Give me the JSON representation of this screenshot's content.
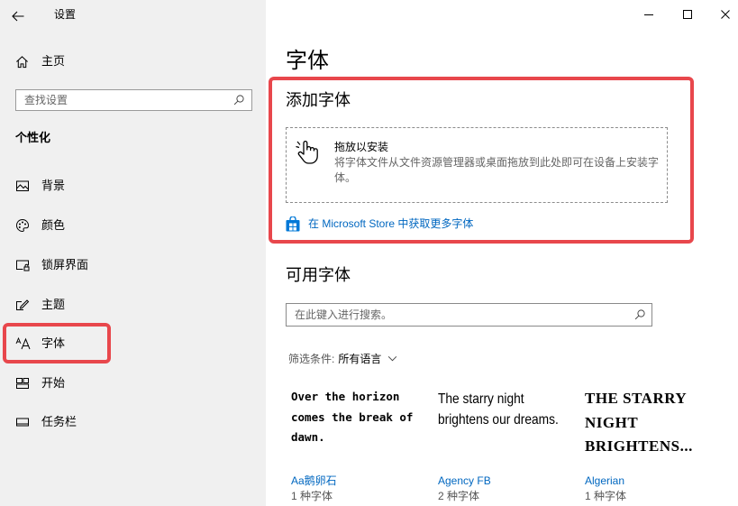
{
  "window": {
    "title": "设置",
    "back_icon": "back-arrow-icon",
    "controls": [
      "minimize-icon",
      "maximize-icon",
      "close-icon"
    ]
  },
  "sidebar": {
    "home": {
      "label": "主页",
      "icon": "home-icon"
    },
    "search": {
      "placeholder": "查找设置",
      "icon": "search-icon"
    },
    "section_title": "个性化",
    "items": [
      {
        "label": "背景",
        "icon": "picture-icon"
      },
      {
        "label": "颜色",
        "icon": "palette-icon"
      },
      {
        "label": "锁屏界面",
        "icon": "lock-screen-icon"
      },
      {
        "label": "主题",
        "icon": "theme-icon"
      },
      {
        "label": "字体",
        "icon": "font-icon",
        "selected": true
      },
      {
        "label": "开始",
        "icon": "start-icon"
      },
      {
        "label": "任务栏",
        "icon": "taskbar-icon"
      }
    ]
  },
  "main": {
    "page_title": "字体",
    "add_fonts": {
      "title": "添加字体",
      "drop_icon": "hand-drag-icon",
      "drop_title": "拖放以安装",
      "drop_description": "将字体文件从文件资源管理器或桌面拖放到此处即可在设备上安装字体。",
      "store_icon": "store-icon",
      "store_link": "在 Microsoft Store 中获取更多字体"
    },
    "available_fonts": {
      "title": "可用字体",
      "search": {
        "placeholder": "在此键入进行搜索。",
        "icon": "search-icon"
      },
      "filter": {
        "label": "筛选条件:",
        "value": "所有语言",
        "icon": "chevron-down-icon"
      },
      "fonts": [
        {
          "name": "Aa鹅卵石",
          "count": "1 种字体",
          "preview": "Over the horizon comes the break of dawn."
        },
        {
          "name": "Agency FB",
          "count": "2 种字体",
          "preview": "The starry night brightens our dreams."
        },
        {
          "name": "Algerian",
          "count": "1 种字体",
          "preview": "THE STARRY NIGHT BRIGHTENS..."
        }
      ]
    }
  },
  "colors": {
    "accent": "#0067c0",
    "store_icon": "#0078d7",
    "highlight_box": "#e8474c",
    "sidebar_background": "#f0f0f0",
    "content_background": "#ffffff"
  }
}
